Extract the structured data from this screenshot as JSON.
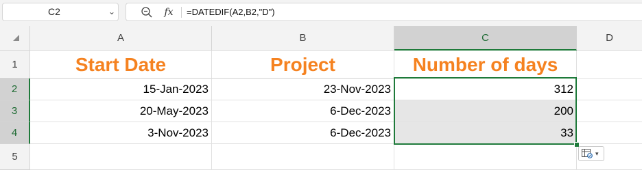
{
  "name_box": {
    "value": "C2",
    "dropdown_icon": "chevron-down-icon"
  },
  "formula_bar": {
    "zoom_icon": "zoom-icon",
    "fx_label": "fx",
    "formula": "=DATEDIF(A2,B2,\"D\")"
  },
  "columns": [
    "A",
    "B",
    "C",
    "D"
  ],
  "rows": [
    "1",
    "2",
    "3",
    "4",
    "5"
  ],
  "header_row": {
    "a": "Start Date",
    "b": "Project",
    "c": "Number of days"
  },
  "data_rows": [
    {
      "a": "15-Jan-2023",
      "b": "23-Nov-2023",
      "c": "312"
    },
    {
      "a": "20-May-2023",
      "b": "6-Dec-2023",
      "c": "200"
    },
    {
      "a": "3-Nov-2023",
      "b": "6-Dec-2023",
      "c": "33"
    }
  ],
  "selected": {
    "cell": "C2",
    "range": "C2:C4"
  },
  "quick_analysis": {
    "icon": "quick-analysis-icon",
    "dropdown_icon": "chevron-down-icon"
  },
  "colors": {
    "header_text": "#f58220",
    "selection": "#1e7a3a",
    "selected_fill": "#e6e6e6"
  }
}
